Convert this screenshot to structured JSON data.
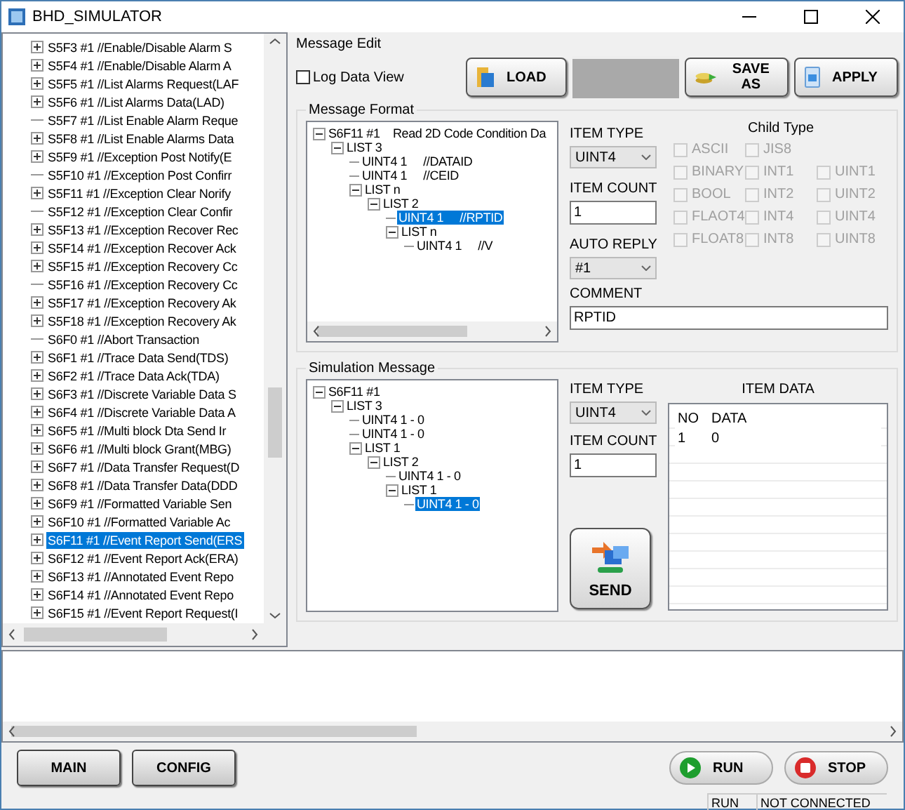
{
  "window": {
    "title": "BHD_SIMULATOR"
  },
  "message_list": [
    {
      "label": "S5F3 #1  //Enable/Disable Alarm S",
      "kind": "branch",
      "selected": false
    },
    {
      "label": "S5F4 #1  //Enable/Disable Alarm A",
      "kind": "branch",
      "selected": false
    },
    {
      "label": "S5F5 #1  //List Alarms Request(LAF",
      "kind": "branch",
      "selected": false
    },
    {
      "label": "S5F6 #1  //List Alarms Data(LAD)",
      "kind": "branch",
      "selected": false
    },
    {
      "label": "S5F7 #1  //List Enable Alarm Reque",
      "kind": "leaf",
      "selected": false
    },
    {
      "label": "S5F8 #1  //List Enable Alarms Data",
      "kind": "branch",
      "selected": false
    },
    {
      "label": "S5F9 #1  //Exception Post Notify(E",
      "kind": "branch",
      "selected": false
    },
    {
      "label": "S5F10 #1  //Exception Post Confirr",
      "kind": "leaf",
      "selected": false
    },
    {
      "label": "S5F11 #1  //Exception Clear Norify",
      "kind": "branch",
      "selected": false
    },
    {
      "label": "S5F12 #1  //Exception Clear Confir",
      "kind": "leaf",
      "selected": false
    },
    {
      "label": "S5F13 #1  //Exception Recover Rec",
      "kind": "branch",
      "selected": false
    },
    {
      "label": "S5F14 #1  //Exception Recover Ack",
      "kind": "branch",
      "selected": false
    },
    {
      "label": "S5F15 #1  //Exception Recovery Cc",
      "kind": "branch",
      "selected": false
    },
    {
      "label": "S5F16 #1  //Exception Recovery Cc",
      "kind": "leaf",
      "selected": false
    },
    {
      "label": "S5F17 #1  //Exception Recovery Ak",
      "kind": "branch",
      "selected": false
    },
    {
      "label": "S5F18 #1  //Exception Recovery Ak",
      "kind": "branch",
      "selected": false
    },
    {
      "label": "S6F0 #1  //Abort Transaction",
      "kind": "leaf",
      "selected": false
    },
    {
      "label": "S6F1 #1  //Trace Data Send(TDS)",
      "kind": "branch",
      "selected": false
    },
    {
      "label": "S6F2 #1  //Trace Data Ack(TDA)",
      "kind": "branch",
      "selected": false
    },
    {
      "label": "S6F3 #1  //Discrete Variable Data S",
      "kind": "branch",
      "selected": false
    },
    {
      "label": "S6F4 #1  //Discrete Variable Data A",
      "kind": "branch",
      "selected": false
    },
    {
      "label": "S6F5 #1  //Multi block Dta Send Ir",
      "kind": "branch",
      "selected": false
    },
    {
      "label": "S6F6 #1  //Multi block Grant(MBG)",
      "kind": "branch",
      "selected": false
    },
    {
      "label": "S6F7 #1  //Data Transfer Request(D",
      "kind": "branch",
      "selected": false
    },
    {
      "label": "S6F8 #1  //Data Transfer Data(DDD",
      "kind": "branch",
      "selected": false
    },
    {
      "label": "S6F9 #1  //Formatted Variable Sen",
      "kind": "branch",
      "selected": false
    },
    {
      "label": "S6F10 #1  //Formatted Variable Ac",
      "kind": "branch",
      "selected": false
    },
    {
      "label": "S6F11 #1  //Event Report Send(ERS",
      "kind": "branch",
      "selected": true
    },
    {
      "label": "S6F12 #1  //Event Report Ack(ERA)",
      "kind": "branch",
      "selected": false
    },
    {
      "label": "S6F13 #1  //Annotated Event Repo",
      "kind": "branch",
      "selected": false
    },
    {
      "label": "S6F14 #1  //Annotated Event Repo",
      "kind": "branch",
      "selected": false
    },
    {
      "label": "S6F15 #1  //Event Report Request(I",
      "kind": "branch",
      "selected": false
    }
  ],
  "message_edit": {
    "title": "Message Edit",
    "log_data_view": {
      "label": "Log Data View",
      "checked": false
    },
    "buttons": [
      {
        "label": "LOAD"
      },
      {
        "label": "SAVE AS"
      },
      {
        "label": "APPLY"
      }
    ]
  },
  "message_format": {
    "title": "Message Format",
    "tree": [
      {
        "label": "S6F11 #1    Read 2D Code Condition Da",
        "selected": false,
        "expanded": true,
        "children": [
          {
            "label": "LIST 3",
            "selected": false,
            "expanded": true,
            "children": [
              {
                "label": "UINT4 1     //DATAID",
                "selected": false
              },
              {
                "label": "UINT4 1     //CEID",
                "selected": false
              },
              {
                "label": "LIST n",
                "selected": false,
                "expanded": true,
                "children": [
                  {
                    "label": "LIST 2",
                    "selected": false,
                    "expanded": true,
                    "children": [
                      {
                        "label": "UINT4 1     //RPTID",
                        "selected": true
                      },
                      {
                        "label": "LIST n",
                        "selected": false,
                        "expanded": true,
                        "children": [
                          {
                            "label": "UINT4 1     //V",
                            "selected": false
                          }
                        ]
                      }
                    ]
                  }
                ]
              }
            ]
          }
        ]
      }
    ],
    "item_type": {
      "label": "ITEM TYPE",
      "value": "UINT4"
    },
    "item_count": {
      "label": "ITEM COUNT",
      "value": "1"
    },
    "auto_reply": {
      "label": "AUTO REPLY",
      "value": "#1"
    },
    "child_type": {
      "title": "Child Type",
      "rows": [
        [
          {
            "label": "ASCII",
            "checked": false,
            "disabled": true
          },
          {
            "label": "JIS8",
            "checked": false,
            "disabled": true
          }
        ],
        [
          {
            "label": "BINARY",
            "checked": false,
            "disabled": true
          },
          {
            "label": "INT1",
            "checked": false,
            "disabled": true
          },
          {
            "label": "UINT1",
            "checked": false,
            "disabled": true
          }
        ],
        [
          {
            "label": "BOOL",
            "checked": false,
            "disabled": true
          },
          {
            "label": "INT2",
            "checked": false,
            "disabled": true
          },
          {
            "label": "UINT2",
            "checked": false,
            "disabled": true
          }
        ],
        [
          {
            "label": "FLAOT4",
            "checked": false,
            "disabled": true
          },
          {
            "label": "INT4",
            "checked": false,
            "disabled": true
          },
          {
            "label": "UINT4",
            "checked": false,
            "disabled": true
          }
        ],
        [
          {
            "label": "FLOAT8",
            "checked": false,
            "disabled": true
          },
          {
            "label": "INT8",
            "checked": false,
            "disabled": true
          },
          {
            "label": "UINT8",
            "checked": false,
            "disabled": true
          }
        ]
      ]
    },
    "comment": {
      "label": "COMMENT",
      "value": "RPTID"
    }
  },
  "simulation_message": {
    "title": "Simulation Message",
    "tree": [
      {
        "label": "S6F11 #1",
        "selected": false,
        "expanded": true,
        "children": [
          {
            "label": "LIST 3",
            "selected": false,
            "expanded": true,
            "children": [
              {
                "label": "UINT4 1 - 0",
                "selected": false
              },
              {
                "label": "UINT4 1 - 0",
                "selected": false
              },
              {
                "label": "LIST 1",
                "selected": false,
                "expanded": true,
                "children": [
                  {
                    "label": "LIST 2",
                    "selected": false,
                    "expanded": true,
                    "children": [
                      {
                        "label": "UINT4 1 - 0",
                        "selected": false
                      },
                      {
                        "label": "LIST 1",
                        "selected": false,
                        "expanded": true,
                        "children": [
                          {
                            "label": "UINT4 1 - 0",
                            "selected": true
                          }
                        ]
                      }
                    ]
                  }
                ]
              }
            ]
          }
        ]
      }
    ],
    "item_type": {
      "label": "ITEM TYPE",
      "value": "UINT4"
    },
    "item_count": {
      "label": "ITEM COUNT",
      "value": "1"
    },
    "send_button": {
      "label": "SEND"
    },
    "item_data": {
      "title": "ITEM DATA",
      "columns": [
        "NO",
        "DATA"
      ],
      "rows": [
        [
          "1",
          "0"
        ]
      ]
    }
  },
  "left_buttons": [
    {
      "label": "MAIN"
    },
    {
      "label": "CONFIG"
    }
  ],
  "right_buttons": [
    {
      "label": "RUN"
    },
    {
      "label": "STOP"
    }
  ],
  "status_bar": [
    "RUN",
    "NOT CONNECTED"
  ]
}
